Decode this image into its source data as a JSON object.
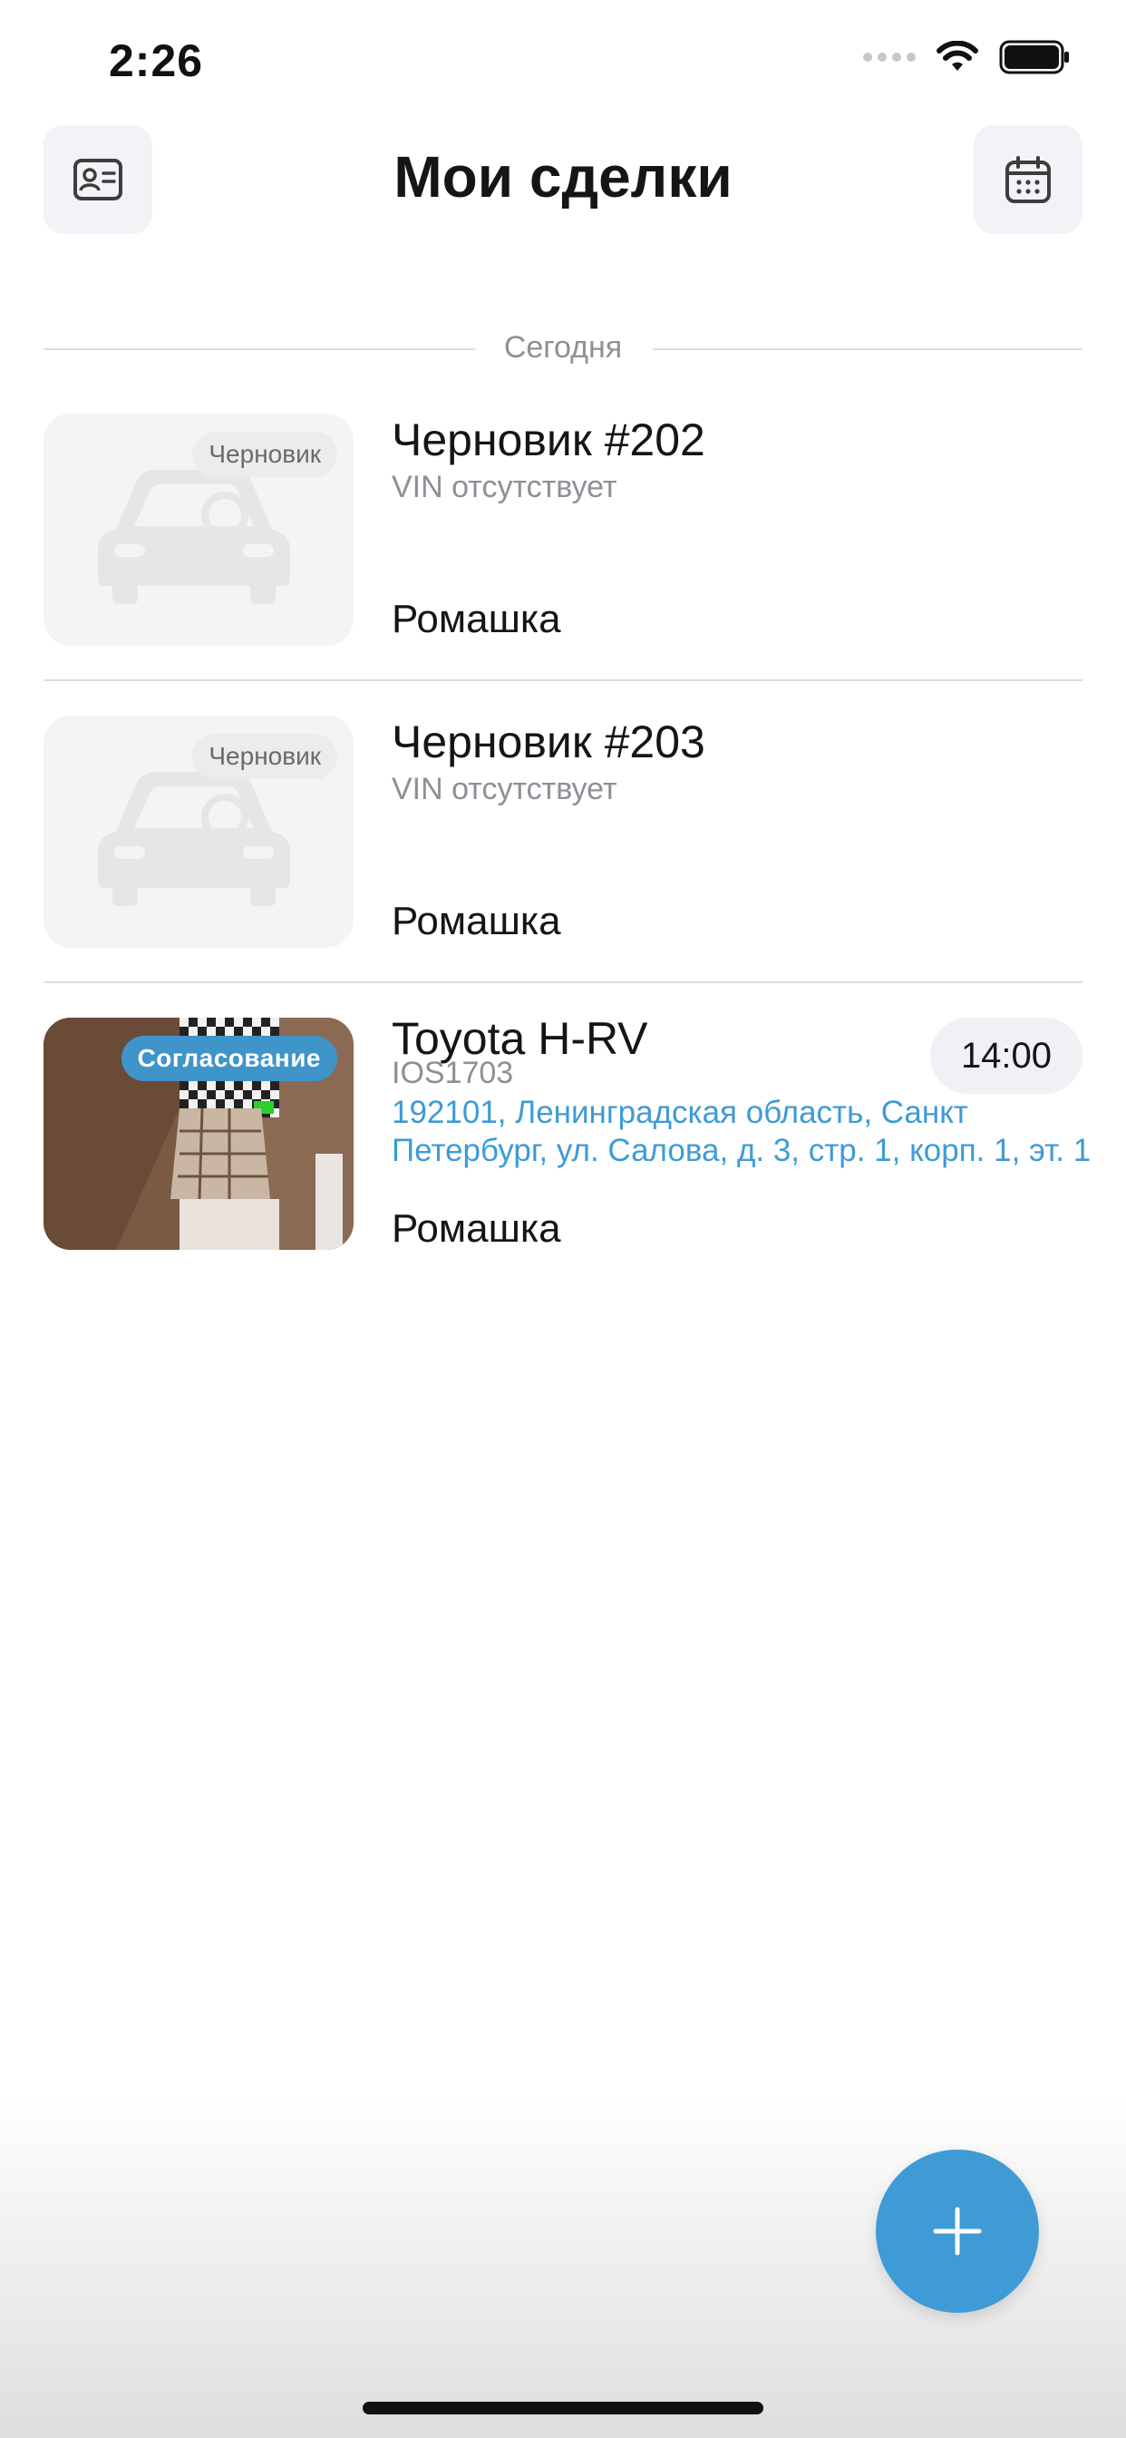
{
  "status_bar": {
    "time": "2:26",
    "signal_icon": "cellular-dots",
    "wifi_icon": "wifi-icon",
    "battery_icon": "battery-icon"
  },
  "header": {
    "title": "Мои сделки",
    "left_button_icon": "contact-card-icon",
    "right_button_icon": "calendar-icon"
  },
  "section": {
    "label": "Сегодня"
  },
  "deals": [
    {
      "status": "Черновик",
      "title": "Черновик #202",
      "subtitle": "VIN отсутствует",
      "company": "Ромашка",
      "thumbnail": "car-placeholder-icon"
    },
    {
      "status": "Черновик",
      "title": "Черновик #203",
      "subtitle": "VIN отсутствует",
      "company": "Ромашка",
      "thumbnail": "car-placeholder-icon"
    },
    {
      "status": "Согласование",
      "title": "Toyota H-RV",
      "subtitle": "IOS1703",
      "address": "192101, Ленинградская область, Санкт Петербург, ул. Салова, д. 3, стр. 1, корп. 1, эт. 1",
      "time": "14:00",
      "company": "Ромашка",
      "thumbnail": "room-photo"
    }
  ],
  "fab": {
    "icon": "plus-icon"
  },
  "colors": {
    "accent": "#3e9bd5",
    "badge_approval": "#3f94c9",
    "muted_text": "#8e9097",
    "button_bg": "#f1f3f6"
  }
}
